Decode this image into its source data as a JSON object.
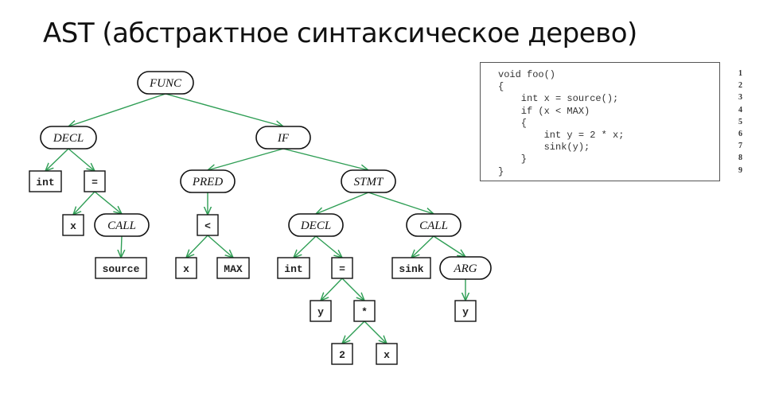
{
  "title": "AST (абстрактное синтаксическое дерево)",
  "colors": {
    "edge": "#2f9e55",
    "node_border": "#111111"
  },
  "tree": {
    "nodes": [
      {
        "id": "func",
        "label": "FUNC",
        "kind": "pill"
      },
      {
        "id": "decl1",
        "label": "DECL",
        "kind": "pill"
      },
      {
        "id": "if",
        "label": "IF",
        "kind": "pill"
      },
      {
        "id": "int1",
        "label": "int",
        "kind": "box"
      },
      {
        "id": "eq1",
        "label": "=",
        "kind": "box"
      },
      {
        "id": "pred",
        "label": "PRED",
        "kind": "pill"
      },
      {
        "id": "stmt",
        "label": "STMT",
        "kind": "pill"
      },
      {
        "id": "x1",
        "label": "x",
        "kind": "box"
      },
      {
        "id": "call1",
        "label": "CALL",
        "kind": "pill"
      },
      {
        "id": "lt",
        "label": "<",
        "kind": "box"
      },
      {
        "id": "decl2",
        "label": "DECL",
        "kind": "pill"
      },
      {
        "id": "call2",
        "label": "CALL",
        "kind": "pill"
      },
      {
        "id": "source",
        "label": "source",
        "kind": "box"
      },
      {
        "id": "x2",
        "label": "x",
        "kind": "box"
      },
      {
        "id": "max",
        "label": "MAX",
        "kind": "box"
      },
      {
        "id": "int2",
        "label": "int",
        "kind": "box"
      },
      {
        "id": "eq2",
        "label": "=",
        "kind": "box"
      },
      {
        "id": "sink",
        "label": "sink",
        "kind": "box"
      },
      {
        "id": "arg",
        "label": "ARG",
        "kind": "pill"
      },
      {
        "id": "y1",
        "label": "y",
        "kind": "box"
      },
      {
        "id": "mul",
        "label": "*",
        "kind": "box"
      },
      {
        "id": "y2",
        "label": "y",
        "kind": "box"
      },
      {
        "id": "two",
        "label": "2",
        "kind": "box"
      },
      {
        "id": "x3",
        "label": "x",
        "kind": "box"
      }
    ],
    "edges": [
      [
        "func",
        "decl1"
      ],
      [
        "func",
        "if"
      ],
      [
        "decl1",
        "int1"
      ],
      [
        "decl1",
        "eq1"
      ],
      [
        "if",
        "pred"
      ],
      [
        "if",
        "stmt"
      ],
      [
        "eq1",
        "x1"
      ],
      [
        "eq1",
        "call1"
      ],
      [
        "pred",
        "lt"
      ],
      [
        "stmt",
        "decl2"
      ],
      [
        "stmt",
        "call2"
      ],
      [
        "call1",
        "source"
      ],
      [
        "lt",
        "x2"
      ],
      [
        "lt",
        "max"
      ],
      [
        "decl2",
        "int2"
      ],
      [
        "decl2",
        "eq2"
      ],
      [
        "call2",
        "sink"
      ],
      [
        "call2",
        "arg"
      ],
      [
        "eq2",
        "y1"
      ],
      [
        "eq2",
        "mul"
      ],
      [
        "arg",
        "y2"
      ],
      [
        "mul",
        "two"
      ],
      [
        "mul",
        "x3"
      ]
    ]
  },
  "code": {
    "lines": [
      "void foo()",
      "{",
      "    int x = source();",
      "    if (x < MAX)",
      "    {",
      "        int y = 2 * x;",
      "        sink(y);",
      "    }",
      "}"
    ],
    "line_numbers": [
      "1",
      "2",
      "3",
      "4",
      "5",
      "6",
      "7",
      "8",
      "9"
    ]
  }
}
